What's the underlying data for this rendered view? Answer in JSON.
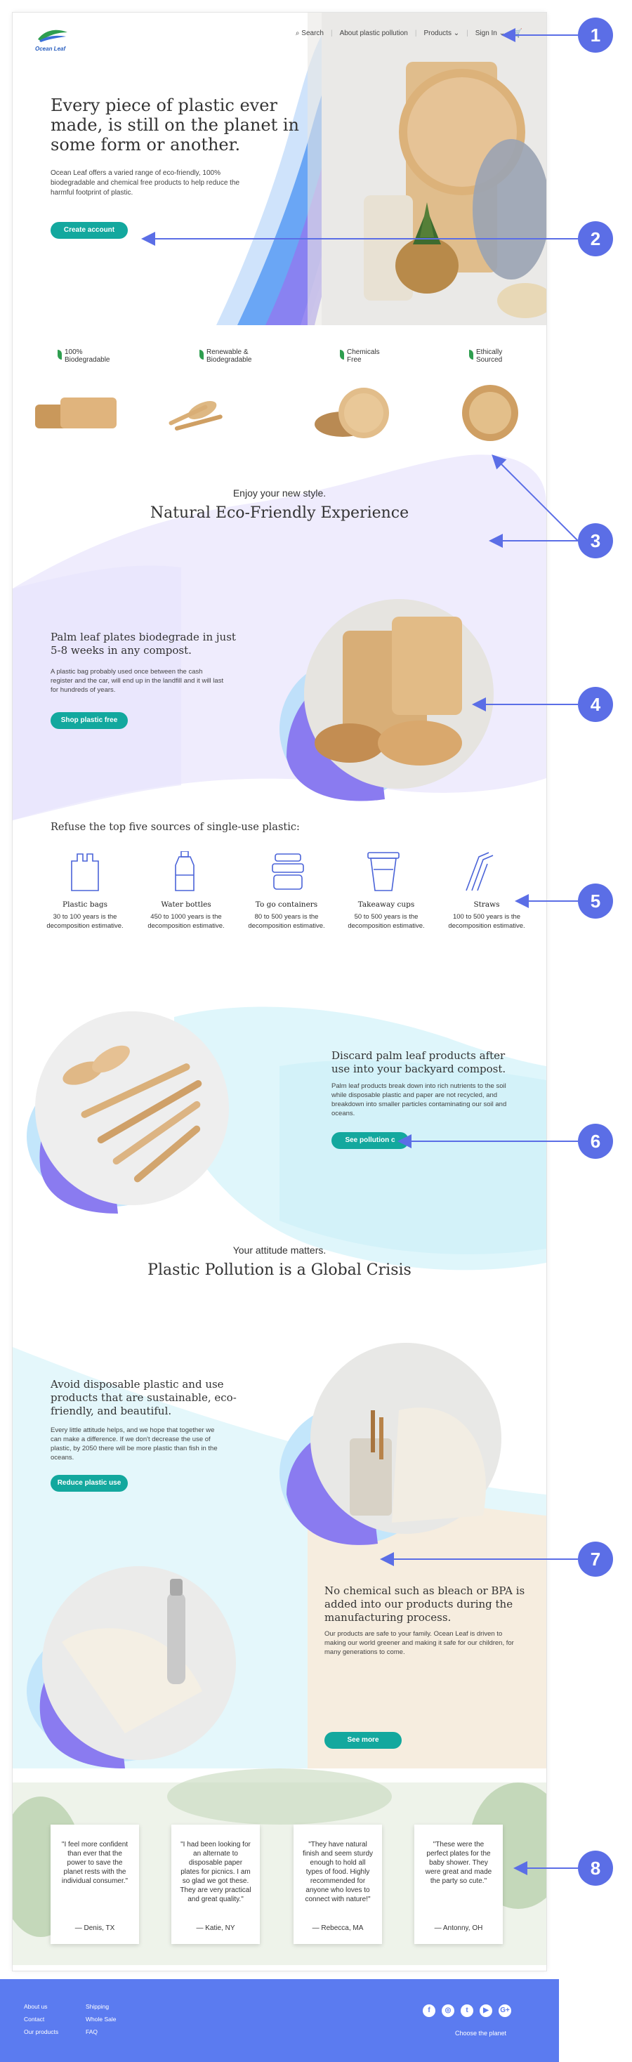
{
  "brand": {
    "name": "Ocean Leaf"
  },
  "nav": {
    "search": "Search",
    "about": "About plastic pollution",
    "products": "Products",
    "signin": "Sign In"
  },
  "hero": {
    "title": "Every piece of plastic ever made, is still on the planet in some form or another.",
    "text": "Ocean Leaf offers a varied range of eco-friendly, 100% biodegradable and chemical free products to help reduce the harmful footprint of plastic.",
    "cta": "Create account"
  },
  "features": [
    {
      "label": "100% Biodegradable"
    },
    {
      "label": "Renewable & Biodegradable"
    },
    {
      "label": "Chemicals Free"
    },
    {
      "label": "Ethically Sourced"
    }
  ],
  "style_section": {
    "kicker": "Enjoy your new style.",
    "title": "Natural Eco-Friendly Experience"
  },
  "palm": {
    "title": "Palm leaf plates biodegrade in just 5-8 weeks in any compost.",
    "text": "A plastic bag probably used once between the cash register and the car, will end up in the landfill and it will last for hundreds of years.",
    "cta": "Shop plastic free"
  },
  "sources": {
    "title": "Refuse the top five sources of single-use plastic:",
    "items": [
      {
        "name": "Plastic bags",
        "desc": "30 to 100 years is the decomposition estimative.",
        "icon": "plastic-bag-icon"
      },
      {
        "name": "Water bottles",
        "desc": "450 to 1000 years is the decomposition estimative.",
        "icon": "water-bottle-icon"
      },
      {
        "name": "To go containers",
        "desc": "80 to 500 years is the decomposition estimative.",
        "icon": "container-icon"
      },
      {
        "name": "Takeaway cups",
        "desc": "50 to 500 years is the decomposition estimative.",
        "icon": "cup-icon"
      },
      {
        "name": "Straws",
        "desc": "100 to 500 years is the decomposition estimative.",
        "icon": "straw-icon"
      }
    ]
  },
  "discard": {
    "title": "Discard palm leaf products after use into your backyard compost.",
    "text": "Palm leaf products break down into rich nutrients to the soil while disposable plastic and paper are not recycled, and breakdown into smaller particles contaminating our soil and oceans.",
    "cta": "See pollution c"
  },
  "attitude": {
    "kicker": "Your attitude matters.",
    "title": "Plastic Pollution is a Global Crisis"
  },
  "avoid": {
    "title": "Avoid disposable plastic and use products that are sustainable, eco-friendly, and beautiful.",
    "text": "Every little attitude helps, and we hope that together we can make a difference. If we don't decrease the use of plastic, by 2050 there will be more plastic than fish in the oceans.",
    "cta": "Reduce plastic use"
  },
  "chemical": {
    "title": "No chemical such as bleach or BPA is added into our products during the manufacturing process.",
    "text": "Our products are safe to your family. Ocean Leaf is driven to making our world greener and making it safe for our children, for many generations to come.",
    "cta": "See more"
  },
  "testimonials": [
    {
      "quote": "\"I feel more confident than ever that the power to save the planet rests with the individual consumer.\"",
      "author": "— Denis, TX"
    },
    {
      "quote": "\"I had been looking for an alternate to disposable paper plates for picnics. I am so glad we got these. They are very practical and great quality.\"",
      "author": "— Katie, NY"
    },
    {
      "quote": "\"They have natural finish and seem sturdy enough to hold all types of food. Highly recommended for anyone who loves to connect with nature!\"",
      "author": "— Rebecca, MA"
    },
    {
      "quote": "\"These were the perfect plates for the baby shower. They were great and made the party so cute.\"",
      "author": "— Antonny, OH"
    }
  ],
  "footer": {
    "col1": [
      "About us",
      "Contact",
      "Our products"
    ],
    "col2": [
      "Shipping",
      "Whole Sale",
      "FAQ"
    ],
    "tagline": "Choose the planet",
    "social": [
      "f",
      "◎",
      "t",
      "▶",
      "G+"
    ]
  },
  "markers": [
    "1",
    "2",
    "3",
    "4",
    "5",
    "6",
    "7",
    "8"
  ],
  "colors": {
    "accent": "#13a89e",
    "marker": "#5b6ee6",
    "footer": "#5b7bf0"
  }
}
